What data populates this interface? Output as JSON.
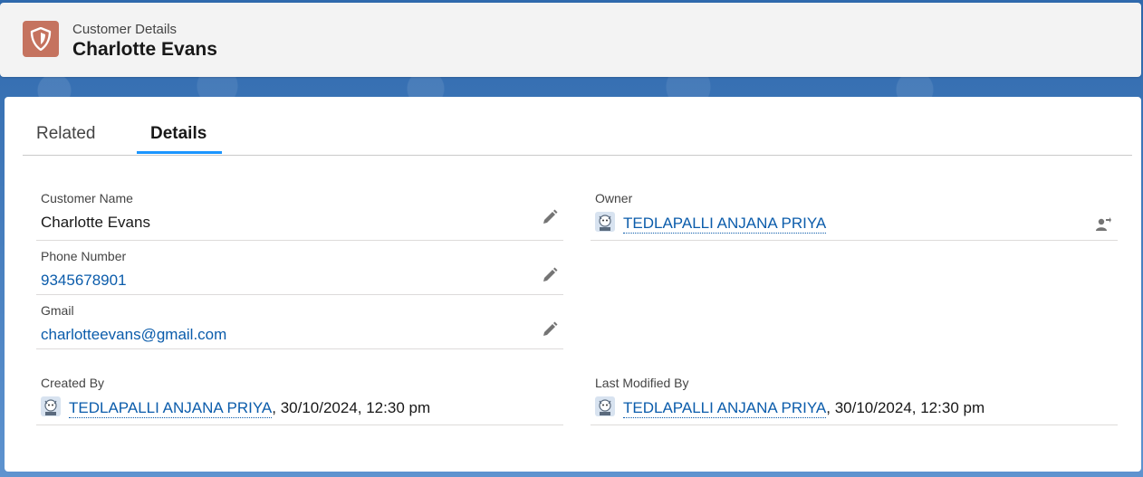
{
  "header": {
    "object_label": "Customer Details",
    "record_name": "Charlotte Evans",
    "icon": "shield-icon",
    "icon_color": "#c5735f"
  },
  "tabs": [
    {
      "label": "Related",
      "active": false
    },
    {
      "label": "Details",
      "active": true
    }
  ],
  "fields": {
    "customer_name": {
      "label": "Customer Name",
      "value": "Charlotte Evans"
    },
    "owner": {
      "label": "Owner",
      "value": "TEDLAPALLI ANJANA PRIYA"
    },
    "phone": {
      "label": "Phone Number",
      "value": "9345678901"
    },
    "gmail": {
      "label": "Gmail",
      "value": "charlotteevans@gmail.com"
    },
    "created_by": {
      "label": "Created By",
      "user": "TEDLAPALLI ANJANA PRIYA",
      "timestamp": ", 30/10/2024, 12:30 pm"
    },
    "last_modified_by": {
      "label": "Last Modified By",
      "user": "TEDLAPALLI ANJANA PRIYA",
      "timestamp": ", 30/10/2024, 12:30 pm"
    }
  },
  "colors": {
    "link": "#0b5cab",
    "tab_active_indicator": "#1b96ff"
  }
}
